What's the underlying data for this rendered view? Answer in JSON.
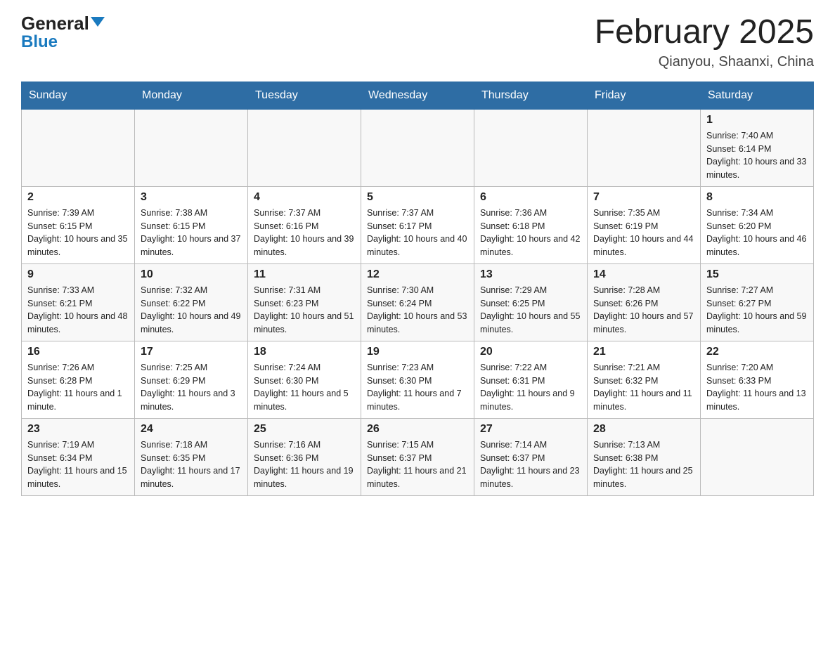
{
  "header": {
    "logo_general": "General",
    "logo_blue": "Blue",
    "title": "February 2025",
    "subtitle": "Qianyou, Shaanxi, China"
  },
  "days_of_week": [
    "Sunday",
    "Monday",
    "Tuesday",
    "Wednesday",
    "Thursday",
    "Friday",
    "Saturday"
  ],
  "weeks": [
    [
      {
        "day": "",
        "sunrise": "",
        "sunset": "",
        "daylight": ""
      },
      {
        "day": "",
        "sunrise": "",
        "sunset": "",
        "daylight": ""
      },
      {
        "day": "",
        "sunrise": "",
        "sunset": "",
        "daylight": ""
      },
      {
        "day": "",
        "sunrise": "",
        "sunset": "",
        "daylight": ""
      },
      {
        "day": "",
        "sunrise": "",
        "sunset": "",
        "daylight": ""
      },
      {
        "day": "",
        "sunrise": "",
        "sunset": "",
        "daylight": ""
      },
      {
        "day": "1",
        "sunrise": "Sunrise: 7:40 AM",
        "sunset": "Sunset: 6:14 PM",
        "daylight": "Daylight: 10 hours and 33 minutes."
      }
    ],
    [
      {
        "day": "2",
        "sunrise": "Sunrise: 7:39 AM",
        "sunset": "Sunset: 6:15 PM",
        "daylight": "Daylight: 10 hours and 35 minutes."
      },
      {
        "day": "3",
        "sunrise": "Sunrise: 7:38 AM",
        "sunset": "Sunset: 6:15 PM",
        "daylight": "Daylight: 10 hours and 37 minutes."
      },
      {
        "day": "4",
        "sunrise": "Sunrise: 7:37 AM",
        "sunset": "Sunset: 6:16 PM",
        "daylight": "Daylight: 10 hours and 39 minutes."
      },
      {
        "day": "5",
        "sunrise": "Sunrise: 7:37 AM",
        "sunset": "Sunset: 6:17 PM",
        "daylight": "Daylight: 10 hours and 40 minutes."
      },
      {
        "day": "6",
        "sunrise": "Sunrise: 7:36 AM",
        "sunset": "Sunset: 6:18 PM",
        "daylight": "Daylight: 10 hours and 42 minutes."
      },
      {
        "day": "7",
        "sunrise": "Sunrise: 7:35 AM",
        "sunset": "Sunset: 6:19 PM",
        "daylight": "Daylight: 10 hours and 44 minutes."
      },
      {
        "day": "8",
        "sunrise": "Sunrise: 7:34 AM",
        "sunset": "Sunset: 6:20 PM",
        "daylight": "Daylight: 10 hours and 46 minutes."
      }
    ],
    [
      {
        "day": "9",
        "sunrise": "Sunrise: 7:33 AM",
        "sunset": "Sunset: 6:21 PM",
        "daylight": "Daylight: 10 hours and 48 minutes."
      },
      {
        "day": "10",
        "sunrise": "Sunrise: 7:32 AM",
        "sunset": "Sunset: 6:22 PM",
        "daylight": "Daylight: 10 hours and 49 minutes."
      },
      {
        "day": "11",
        "sunrise": "Sunrise: 7:31 AM",
        "sunset": "Sunset: 6:23 PM",
        "daylight": "Daylight: 10 hours and 51 minutes."
      },
      {
        "day": "12",
        "sunrise": "Sunrise: 7:30 AM",
        "sunset": "Sunset: 6:24 PM",
        "daylight": "Daylight: 10 hours and 53 minutes."
      },
      {
        "day": "13",
        "sunrise": "Sunrise: 7:29 AM",
        "sunset": "Sunset: 6:25 PM",
        "daylight": "Daylight: 10 hours and 55 minutes."
      },
      {
        "day": "14",
        "sunrise": "Sunrise: 7:28 AM",
        "sunset": "Sunset: 6:26 PM",
        "daylight": "Daylight: 10 hours and 57 minutes."
      },
      {
        "day": "15",
        "sunrise": "Sunrise: 7:27 AM",
        "sunset": "Sunset: 6:27 PM",
        "daylight": "Daylight: 10 hours and 59 minutes."
      }
    ],
    [
      {
        "day": "16",
        "sunrise": "Sunrise: 7:26 AM",
        "sunset": "Sunset: 6:28 PM",
        "daylight": "Daylight: 11 hours and 1 minute."
      },
      {
        "day": "17",
        "sunrise": "Sunrise: 7:25 AM",
        "sunset": "Sunset: 6:29 PM",
        "daylight": "Daylight: 11 hours and 3 minutes."
      },
      {
        "day": "18",
        "sunrise": "Sunrise: 7:24 AM",
        "sunset": "Sunset: 6:30 PM",
        "daylight": "Daylight: 11 hours and 5 minutes."
      },
      {
        "day": "19",
        "sunrise": "Sunrise: 7:23 AM",
        "sunset": "Sunset: 6:30 PM",
        "daylight": "Daylight: 11 hours and 7 minutes."
      },
      {
        "day": "20",
        "sunrise": "Sunrise: 7:22 AM",
        "sunset": "Sunset: 6:31 PM",
        "daylight": "Daylight: 11 hours and 9 minutes."
      },
      {
        "day": "21",
        "sunrise": "Sunrise: 7:21 AM",
        "sunset": "Sunset: 6:32 PM",
        "daylight": "Daylight: 11 hours and 11 minutes."
      },
      {
        "day": "22",
        "sunrise": "Sunrise: 7:20 AM",
        "sunset": "Sunset: 6:33 PM",
        "daylight": "Daylight: 11 hours and 13 minutes."
      }
    ],
    [
      {
        "day": "23",
        "sunrise": "Sunrise: 7:19 AM",
        "sunset": "Sunset: 6:34 PM",
        "daylight": "Daylight: 11 hours and 15 minutes."
      },
      {
        "day": "24",
        "sunrise": "Sunrise: 7:18 AM",
        "sunset": "Sunset: 6:35 PM",
        "daylight": "Daylight: 11 hours and 17 minutes."
      },
      {
        "day": "25",
        "sunrise": "Sunrise: 7:16 AM",
        "sunset": "Sunset: 6:36 PM",
        "daylight": "Daylight: 11 hours and 19 minutes."
      },
      {
        "day": "26",
        "sunrise": "Sunrise: 7:15 AM",
        "sunset": "Sunset: 6:37 PM",
        "daylight": "Daylight: 11 hours and 21 minutes."
      },
      {
        "day": "27",
        "sunrise": "Sunrise: 7:14 AM",
        "sunset": "Sunset: 6:37 PM",
        "daylight": "Daylight: 11 hours and 23 minutes."
      },
      {
        "day": "28",
        "sunrise": "Sunrise: 7:13 AM",
        "sunset": "Sunset: 6:38 PM",
        "daylight": "Daylight: 11 hours and 25 minutes."
      },
      {
        "day": "",
        "sunrise": "",
        "sunset": "",
        "daylight": ""
      }
    ]
  ]
}
